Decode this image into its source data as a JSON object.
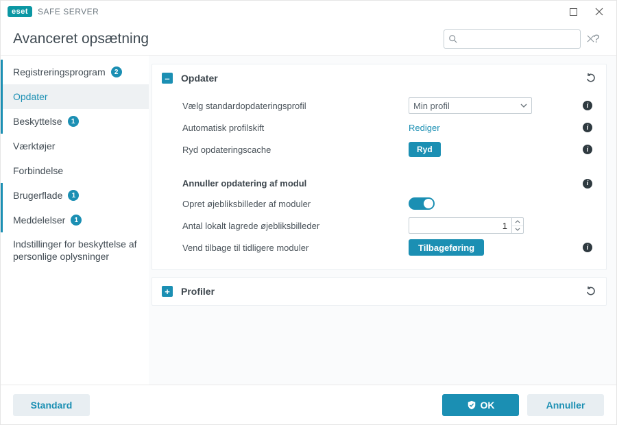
{
  "titlebar": {
    "brand": "eset",
    "product": "SAFE SERVER"
  },
  "header": {
    "title": "Avanceret opsætning",
    "search_placeholder": ""
  },
  "sidebar": {
    "items": [
      {
        "label": "Registreringsprogram",
        "badge": "2",
        "marked": true
      },
      {
        "label": "Opdater",
        "active": true
      },
      {
        "label": "Beskyttelse",
        "badge": "1",
        "marked": true
      },
      {
        "label": "Værktøjer"
      },
      {
        "label": "Forbindelse"
      },
      {
        "label": "Brugerflade",
        "badge": "1",
        "marked": true
      },
      {
        "label": "Meddelelser",
        "badge": "1",
        "marked": true
      },
      {
        "label": "Indstillinger for beskyttelse af personlige oplysninger",
        "multiline": true
      }
    ]
  },
  "panels": {
    "update": {
      "title": "Opdater",
      "profile_row": {
        "label": "Vælg standardopdateringsprofil",
        "value": "Min profil"
      },
      "autoswitch_row": {
        "label": "Automatisk profilskift",
        "action": "Rediger"
      },
      "clearcache_row": {
        "label": "Ryd opdateringscache",
        "button": "Ryd"
      },
      "subheading": "Annuller opdatering af modul",
      "snapshot_row": {
        "label": "Opret øjebliksbilleder af moduler",
        "on": true
      },
      "count_row": {
        "label": "Antal lokalt lagrede øjebliksbilleder",
        "value": "1"
      },
      "rollback_row": {
        "label": "Vend tilbage til tidligere moduler",
        "button": "Tilbageføring"
      }
    },
    "profiles": {
      "title": "Profiler"
    }
  },
  "footer": {
    "default": "Standard",
    "ok": "OK",
    "cancel": "Annuller"
  },
  "icons": {
    "info": "i"
  }
}
